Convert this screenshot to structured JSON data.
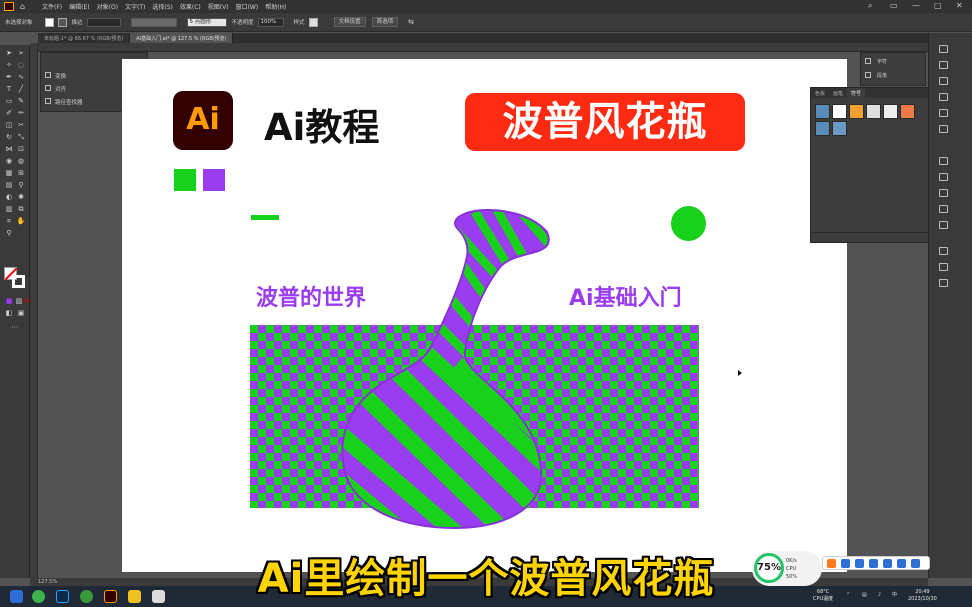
{
  "app": {
    "menus": [
      "文件(F)",
      "编辑(E)",
      "对象(O)",
      "文字(T)",
      "选择(S)",
      "效果(C)",
      "视图(V)",
      "窗口(W)",
      "帮助(H)"
    ],
    "window_controls": [
      "search-icon",
      "minimize-icon",
      "maximize-icon",
      "close-icon"
    ]
  },
  "control_bar": {
    "selection": "未选择对象",
    "stroke_label": "描边",
    "point_value": "5 点圆形",
    "opacity_label": "不透明度",
    "opacity_value": "100%",
    "style_label": "样式",
    "doc_setup": "文档设置",
    "preferences": "首选项"
  },
  "tabs": [
    {
      "label": "未标题-1* @ 66.67 % (RGB/预览)",
      "active": false
    },
    {
      "label": "Ai基础入门.ai* @ 127.5 % (RGB/预览)",
      "active": true
    }
  ],
  "props_panel": {
    "items": [
      "变换",
      "对齐",
      "路径查找器"
    ]
  },
  "right_panel": {
    "items": [
      "字符",
      "段落"
    ]
  },
  "symbols_panel": {
    "tabs": [
      "色板",
      "画笔",
      "符号"
    ],
    "active_tab": "符号"
  },
  "artboard": {
    "logo_text": "Ai",
    "heading": "Ai教程",
    "title_badge": "波普风花瓶",
    "sub_left": "波普的世界",
    "sub_right": "Ai基础入门"
  },
  "colors": {
    "green": "#18d11a",
    "purple": "#9a3cf0",
    "badge_red": "#ff2a12",
    "logo_bg": "#330000",
    "logo_orange": "#ff9a00"
  },
  "status_bar": {
    "zoom": "127.5%"
  },
  "subtitle": "Ai里绘制一个波普风花瓶",
  "perf": {
    "gauge": "75%",
    "net_label": "0K/s",
    "cpu_label": "CPU 50%"
  },
  "tray": {
    "temp": "68°C",
    "cpu_temp": "CPU温度",
    "time": "20:49",
    "date": "2023/10/30"
  }
}
